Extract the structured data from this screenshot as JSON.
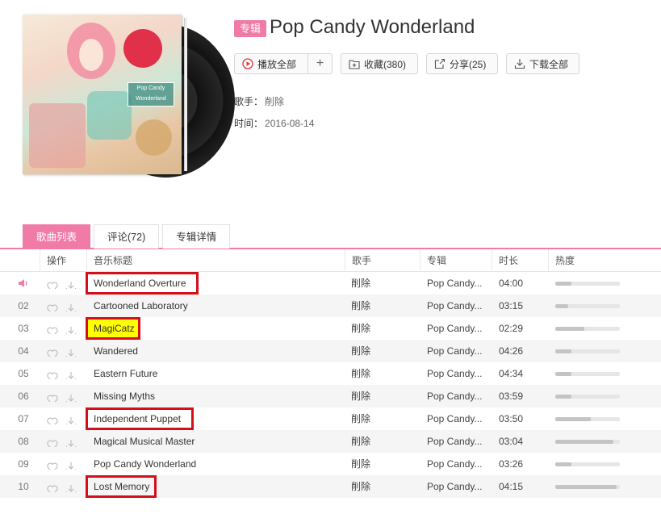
{
  "album": {
    "tag": "专辑",
    "title": "Pop Candy Wonderland",
    "cover_logo": "Pop Candy Wonderland",
    "artist_label": "歌手：",
    "artist": "削除",
    "date_label": "时间：",
    "date": "2016-08-14"
  },
  "actions": {
    "play_all": "播放全部",
    "add": "+",
    "collect": "收藏(380)",
    "share": "分享(25)",
    "download_all": "下载全部"
  },
  "tabs": [
    {
      "label": "歌曲列表",
      "active": true
    },
    {
      "label": "评论(72)",
      "active": false
    },
    {
      "label": "专辑详情",
      "active": false
    }
  ],
  "table": {
    "headers": {
      "op": "操作",
      "title": "音乐标题",
      "artist": "歌手",
      "album": "专辑",
      "duration": "时长",
      "heat": "热度"
    },
    "rows": [
      {
        "num": "",
        "playing": true,
        "title": "Wonderland Overture",
        "artist": "削除",
        "album": "Pop Candy...",
        "duration": "04:00",
        "heat": 0.25,
        "highlight": "red-box"
      },
      {
        "num": "02",
        "title": "Cartooned Laboratory",
        "artist": "削除",
        "album": "Pop Candy...",
        "duration": "03:15",
        "heat": 0.2,
        "highlight": ""
      },
      {
        "num": "03",
        "title": "MagiCatz",
        "artist": "削除",
        "album": "Pop Candy...",
        "duration": "02:29",
        "heat": 0.45,
        "highlight": "yellow-red-box"
      },
      {
        "num": "04",
        "title": "Wandered",
        "artist": "削除",
        "album": "Pop Candy...",
        "duration": "04:26",
        "heat": 0.25,
        "highlight": ""
      },
      {
        "num": "05",
        "title": "Eastern Future",
        "artist": "削除",
        "album": "Pop Candy...",
        "duration": "04:34",
        "heat": 0.25,
        "highlight": ""
      },
      {
        "num": "06",
        "title": "Missing Myths",
        "artist": "削除",
        "album": "Pop Candy...",
        "duration": "03:59",
        "heat": 0.25,
        "highlight": ""
      },
      {
        "num": "07",
        "title": "Independent Puppet",
        "artist": "削除",
        "album": "Pop Candy...",
        "duration": "03:50",
        "heat": 0.55,
        "highlight": "red-box"
      },
      {
        "num": "08",
        "title": "Magical Musical Master",
        "artist": "削除",
        "album": "Pop Candy...",
        "duration": "03:04",
        "heat": 0.9,
        "highlight": ""
      },
      {
        "num": "09",
        "title": "Pop Candy Wonderland",
        "artist": "削除",
        "album": "Pop Candy...",
        "duration": "03:26",
        "heat": 0.25,
        "highlight": ""
      },
      {
        "num": "10",
        "title": "Lost Memory",
        "artist": "削除",
        "album": "Pop Candy...",
        "duration": "04:15",
        "heat": 0.95,
        "highlight": "red-box"
      }
    ]
  },
  "colors": {
    "accent": "#f07ba7",
    "highlight_red": "#d40f1a",
    "highlight_yellow": "#ffff00",
    "heat_fill": "#c4c4c4"
  },
  "icons": {
    "playing": "speaker-icon",
    "like": "heart-icon",
    "download": "download-icon",
    "play": "play-circle-icon",
    "collect": "folder-plus-icon",
    "share": "share-icon",
    "download_all": "download-icon"
  }
}
